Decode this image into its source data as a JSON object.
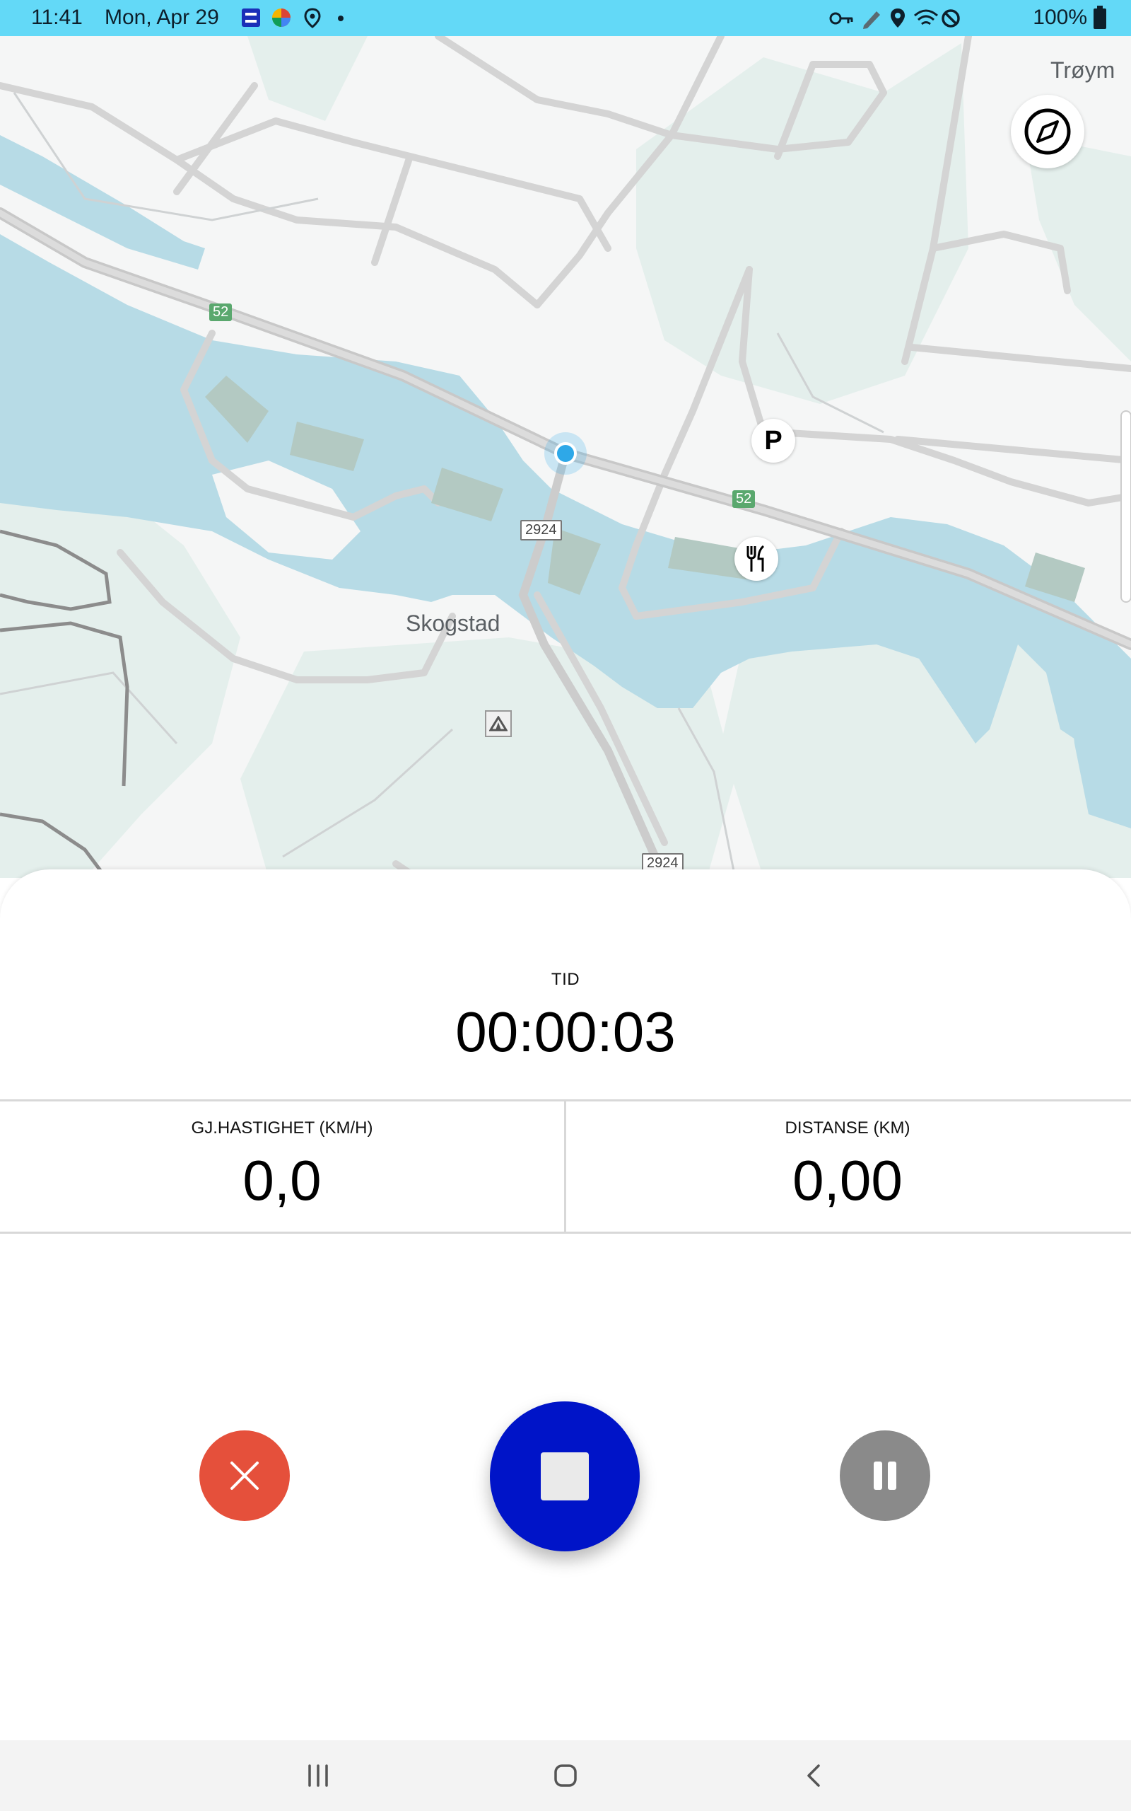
{
  "status_bar": {
    "time": "11:41",
    "date": "Mon, Apr 29",
    "battery": "100%",
    "icons_left": [
      "sb-app-icon",
      "photos-icon",
      "location-icon",
      "dot-icon"
    ],
    "icons_right": [
      "vpn-key-icon",
      "pen-icon",
      "location-icon",
      "wifi-icon",
      "do-not-disturb-icon",
      "battery-icon"
    ]
  },
  "map": {
    "place_labels": {
      "skogstad": "Skogstad",
      "troym": "Trøym"
    },
    "road_shields": {
      "r52_a": "52",
      "r52_b": "52",
      "r2924_a": "2924",
      "r2924_b": "2924"
    },
    "poi": {
      "parking": "P"
    },
    "colors": {
      "water": "#b7dbe6",
      "forest": "#e3eeeb",
      "road": "#d2d2d2",
      "building": "#b3c9c2",
      "location_dot": "#2ea8e8"
    }
  },
  "tracker": {
    "time_label": "TID",
    "time_value": "00:00:03",
    "avg_speed_label": "GJ.HASTIGHET (KM/H)",
    "avg_speed_value": "0,0",
    "distance_label": "DISTANSE (KM)",
    "distance_value": "0,00"
  },
  "controls": {
    "cancel_icon": "close-icon",
    "stop_icon": "stop-icon",
    "pause_icon": "pause-icon",
    "colors": {
      "cancel": "#e5503b",
      "stop": "#0014c8",
      "pause": "#8a8a8a"
    }
  },
  "nav_bar": {
    "icons": [
      "recents-icon",
      "home-icon",
      "back-icon"
    ]
  }
}
